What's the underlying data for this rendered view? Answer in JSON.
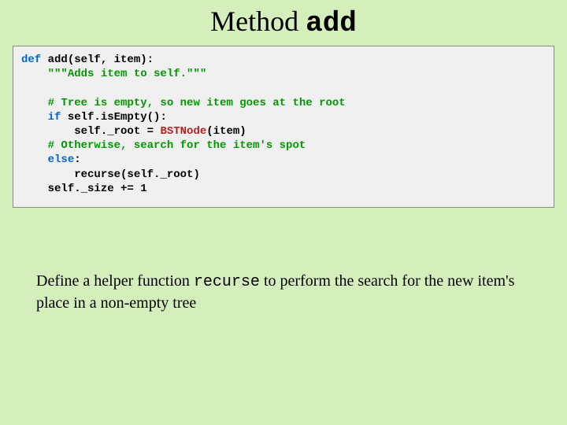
{
  "title": {
    "prefix": "Method ",
    "method": "add"
  },
  "code": {
    "l1_def": "def",
    "l1_rest": " add(self, item):",
    "l2_indent": "    ",
    "l2_str": "\"\"\"Adds item to self.\"\"\"",
    "blank": "",
    "l3_indent": "    ",
    "l3_comment": "# Tree is empty, so new item goes at the root",
    "l4_indent": "    ",
    "l4_if": "if",
    "l4_rest": " self.isEmpty():",
    "l5_indent": "        ",
    "l5a": "self._root = ",
    "l5_cls": "BSTNode",
    "l5b": "(item)",
    "l6_indent": "    ",
    "l6_comment": "# Otherwise, search for the item's spot",
    "l7_indent": "    ",
    "l7_else": "else",
    "l7_rest": ":",
    "l8_indent": "        ",
    "l8": "recurse(self._root)",
    "l9_indent": "    ",
    "l9": "self._size += 1"
  },
  "caption": {
    "part1": "Define a helper function ",
    "mono": "recurse",
    "part2": " to perform the search for the new item's place in a non-empty tree"
  }
}
